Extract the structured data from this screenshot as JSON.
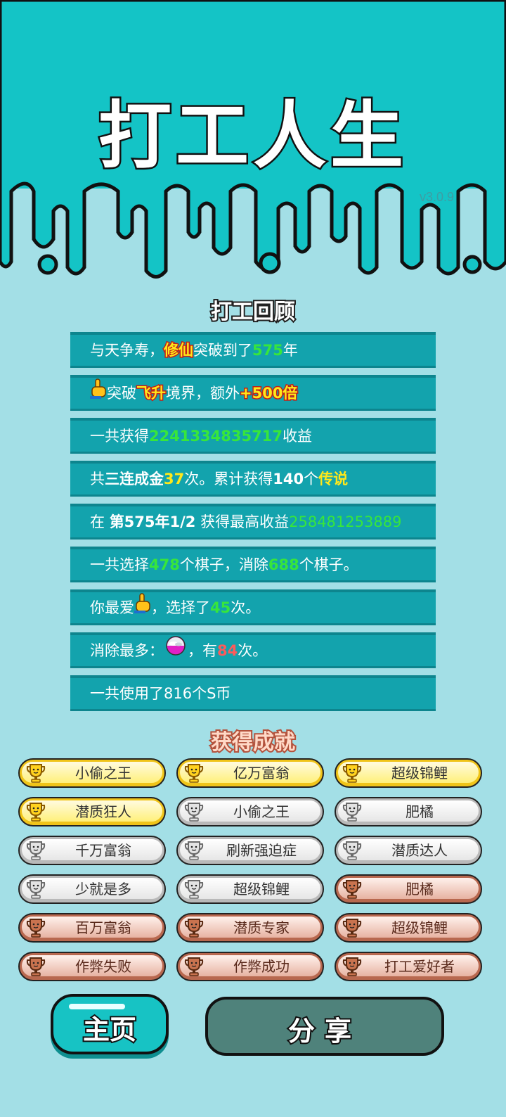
{
  "app": {
    "title": "打工人生",
    "version": "v3.0.9"
  },
  "review": {
    "heading": "打工回顾",
    "row1": {
      "a": "与天争寿，",
      "b": "修仙",
      "c": "突破到了",
      "d": "575",
      "e": "年"
    },
    "row2": {
      "a": "突破",
      "b": "飞升",
      "c": "境界，额外",
      "d": "+500倍"
    },
    "row3": {
      "a": "一共获得",
      "b": "2241334835717",
      "c": "收益"
    },
    "row4": {
      "a": "共",
      "b": "三连成金",
      "c": "37",
      "d": "次。累计获得",
      "e": "140",
      "f": "个",
      "g": "传说"
    },
    "row5": {
      "a": "在 ",
      "b": "第575年1/2",
      "c": " 获得最高收益",
      "d": "258481253889"
    },
    "row6": {
      "a": "一共选择",
      "b": "478",
      "c": "个棋子，消除",
      "d": "688",
      "e": "个棋子。"
    },
    "row7": {
      "a": "你最爱",
      "b": "，选择了",
      "c": "45",
      "d": "次。"
    },
    "row8": {
      "a": "消除最多：",
      "b": "，有",
      "c": "84",
      "d": "次。"
    },
    "row9": {
      "a": "一共使用了816个S币"
    }
  },
  "achievements": {
    "heading": "获得成就",
    "items": [
      {
        "label": "小偷之王",
        "tier": "gold"
      },
      {
        "label": "亿万富翁",
        "tier": "gold"
      },
      {
        "label": "超级锦鲤",
        "tier": "gold"
      },
      {
        "label": "潜质狂人",
        "tier": "gold"
      },
      {
        "label": "小偷之王",
        "tier": "silver"
      },
      {
        "label": "肥橘",
        "tier": "silver"
      },
      {
        "label": "千万富翁",
        "tier": "silver"
      },
      {
        "label": "刷新强迫症",
        "tier": "silver"
      },
      {
        "label": "潜质达人",
        "tier": "silver"
      },
      {
        "label": "少就是多",
        "tier": "silver"
      },
      {
        "label": "超级锦鲤",
        "tier": "silver"
      },
      {
        "label": "肥橘",
        "tier": "bronze"
      },
      {
        "label": "百万富翁",
        "tier": "bronze"
      },
      {
        "label": "潜质专家",
        "tier": "bronze"
      },
      {
        "label": "超级锦鲤",
        "tier": "bronze"
      },
      {
        "label": "作弊失败",
        "tier": "bronze"
      },
      {
        "label": "作弊成功",
        "tier": "bronze"
      },
      {
        "label": "打工爱好者",
        "tier": "bronze"
      }
    ]
  },
  "buttons": {
    "home": "主页",
    "share": "分享"
  },
  "colors": {
    "header": "#14c4c6",
    "background": "#a3dfe6",
    "row": "#13a3ad",
    "share_button": "#4f827b"
  },
  "icons": {
    "row2": "pointing-hand-icon",
    "row7": "pointing-hand-icon",
    "row8": "cloud-orb-icon",
    "trophy": "trophy-icon"
  }
}
